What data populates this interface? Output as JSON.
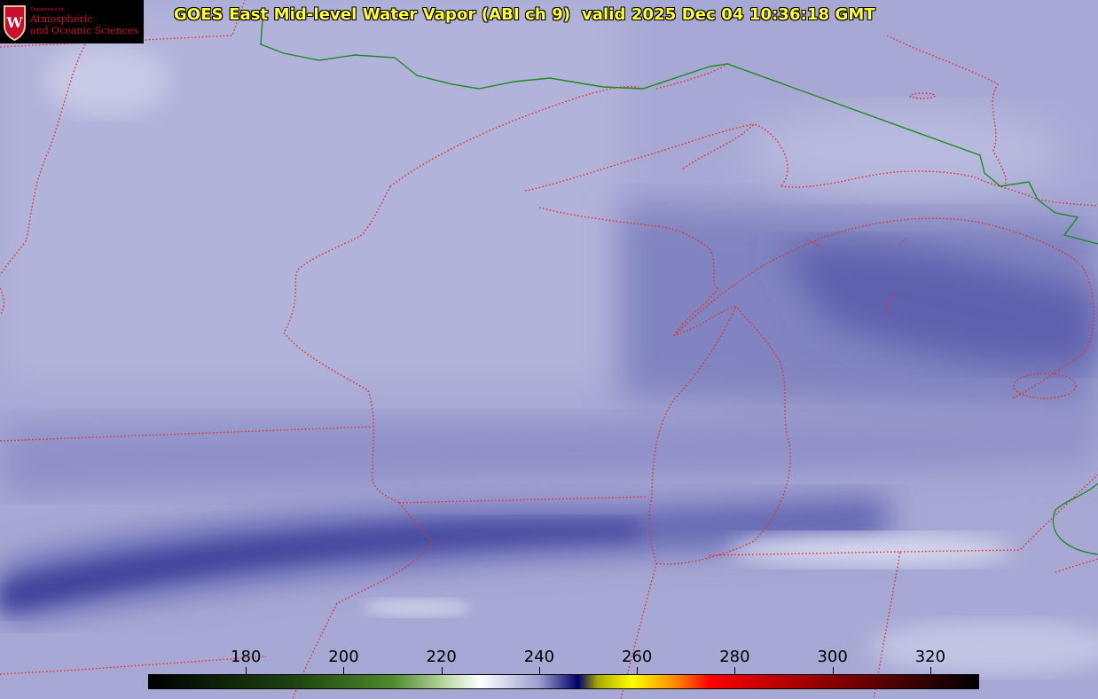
{
  "logo": {
    "department": "Department of",
    "line1": "Atmospheric",
    "line2": "and Oceanic Sciences",
    "crest_letter": "W",
    "crest_icon": "uw-crest-icon"
  },
  "title": "GOES East Mid-level Water Vapor (ABI ch 9)  valid 2025 Dec 04 10:36:18 GMT",
  "colorbar": {
    "range": [
      160,
      330
    ],
    "ticks": [
      {
        "value": 180,
        "label": "180"
      },
      {
        "value": 200,
        "label": "200"
      },
      {
        "value": 220,
        "label": "220"
      },
      {
        "value": 240,
        "label": "240"
      },
      {
        "value": 260,
        "label": "260"
      },
      {
        "value": 280,
        "label": "280"
      },
      {
        "value": 300,
        "label": "300"
      },
      {
        "value": 320,
        "label": "320"
      }
    ],
    "stops": [
      {
        "value": 160,
        "color": "#000000"
      },
      {
        "value": 190,
        "color": "#1e4410"
      },
      {
        "value": 210,
        "color": "#4f8a2c"
      },
      {
        "value": 222,
        "color": "#c8e0b4"
      },
      {
        "value": 228,
        "color": "#ffffff"
      },
      {
        "value": 240,
        "color": "#9c9ed0"
      },
      {
        "value": 248,
        "color": "#00006a"
      },
      {
        "value": 252,
        "color": "#aaaa00"
      },
      {
        "value": 259,
        "color": "#ffff00"
      },
      {
        "value": 268,
        "color": "#ff8800"
      },
      {
        "value": 275,
        "color": "#ff0000"
      },
      {
        "value": 300,
        "color": "#880000"
      },
      {
        "value": 330,
        "color": "#000000"
      }
    ]
  },
  "colors": {
    "background": "#a4a6d2",
    "state_borders": "#e8302a",
    "national_border": "#1e8a1e",
    "title_text": "#ffff33",
    "logo_red": "#c8102e"
  }
}
